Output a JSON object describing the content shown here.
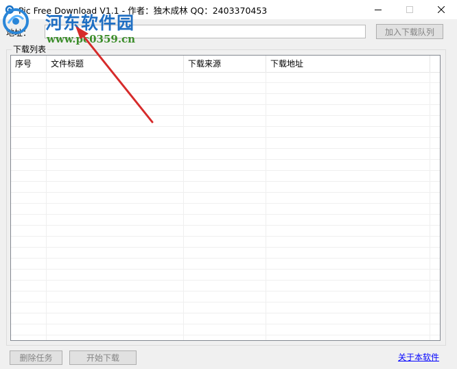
{
  "window": {
    "title": "Pic Free Download V1.1 - 作者：独木成林 QQ：2403370453"
  },
  "address": {
    "label": "地址：",
    "value": "",
    "placeholder": ""
  },
  "buttons": {
    "add_to_queue": "加入下载队列",
    "delete_task": "删除任务",
    "start_download": "开始下载"
  },
  "download_list": {
    "title": "下载列表",
    "columns": [
      "序号",
      "文件标题",
      "下载来源",
      "下载地址"
    ],
    "rows": []
  },
  "about_link": "关于本软件",
  "watermark": {
    "name": "河东软件园",
    "url": "www.pc0359.cn"
  },
  "colors": {
    "link": "#0000ff",
    "arrow": "#d62b2b",
    "watermark_blue": "#1f6fc3",
    "watermark_green": "#3b8d2a"
  }
}
